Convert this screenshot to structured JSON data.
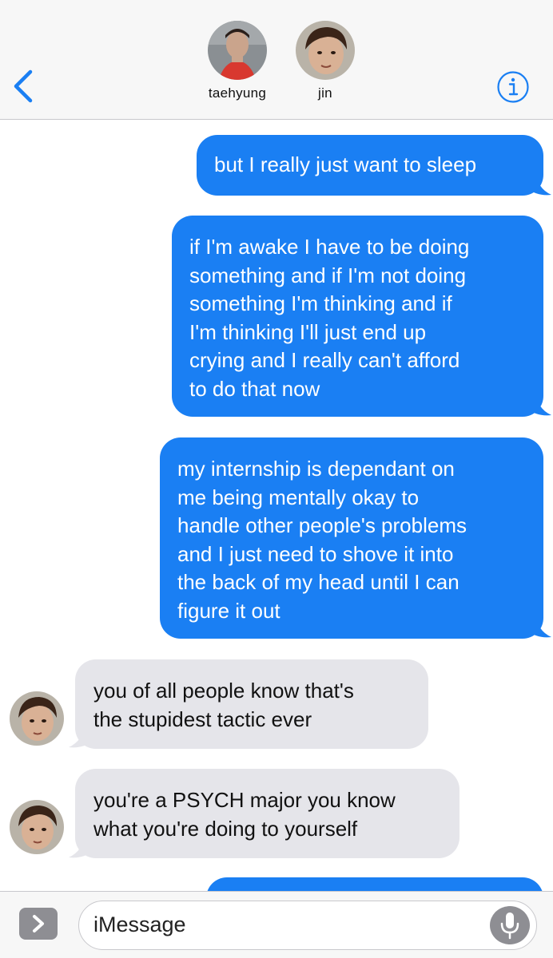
{
  "header": {
    "participants": [
      {
        "name": "taehyung"
      },
      {
        "name": "jin"
      }
    ]
  },
  "messages": [
    {
      "direction": "sent",
      "text": "but I really just want to sleep"
    },
    {
      "direction": "sent",
      "text": "if I'm awake I have to be doing\nsomething and if I'm not doing\nsomething I'm thinking and if\nI'm thinking I'll just end up\ncrying and I really can't afford\nto do that now"
    },
    {
      "direction": "sent",
      "text": "my internship is dependant on\nme being mentally okay to\nhandle other people's problems\nand I just need to shove it into\nthe back of my head until I can\nfigure it out"
    },
    {
      "direction": "received",
      "text": "you of all people know that's\nthe stupidest tactic ever"
    },
    {
      "direction": "received",
      "text": "you're a PSYCH major you know\nwhat you're doing to yourself"
    }
  ],
  "composer": {
    "placeholder": "iMessage"
  },
  "colors": {
    "sent_bubble": "#1a7ff3",
    "received_bubble": "#e5e5ea",
    "accent": "#1a7ff3"
  },
  "icons": [
    "back-chevron-icon",
    "info-icon",
    "apps-chevron-icon",
    "microphone-icon"
  ]
}
